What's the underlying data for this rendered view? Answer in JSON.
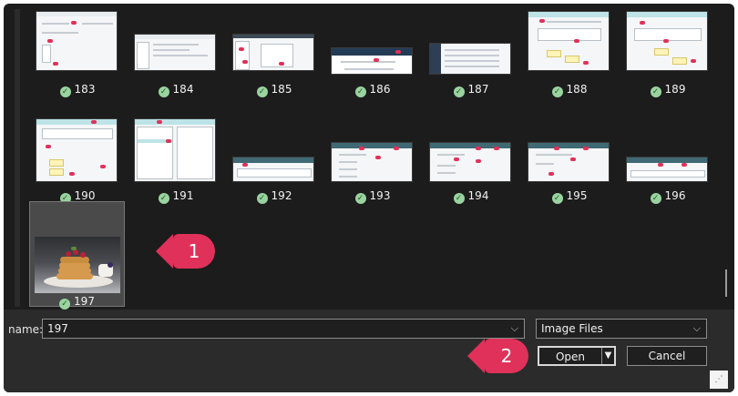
{
  "thumbnails": [
    {
      "label": "183"
    },
    {
      "label": "184"
    },
    {
      "label": "185"
    },
    {
      "label": "186"
    },
    {
      "label": "187"
    },
    {
      "label": "188"
    },
    {
      "label": "189"
    },
    {
      "label": "190"
    },
    {
      "label": "191"
    },
    {
      "label": "192"
    },
    {
      "label": "193"
    },
    {
      "label": "194"
    },
    {
      "label": "195"
    },
    {
      "label": "196"
    },
    {
      "label": "197"
    }
  ],
  "callouts": {
    "one": "1",
    "two": "2"
  },
  "file_name": {
    "label": "name:",
    "value": "197"
  },
  "file_type": {
    "value": "Image Files"
  },
  "buttons": {
    "open": "Open",
    "cancel": "Cancel"
  },
  "icons": {
    "check": "✓",
    "chevron": "⌵",
    "dropdown_arrow": "▼"
  },
  "colors": {
    "accent": "#e0315a",
    "check_green": "#9ad3a0",
    "background": "#1c1c1c"
  }
}
